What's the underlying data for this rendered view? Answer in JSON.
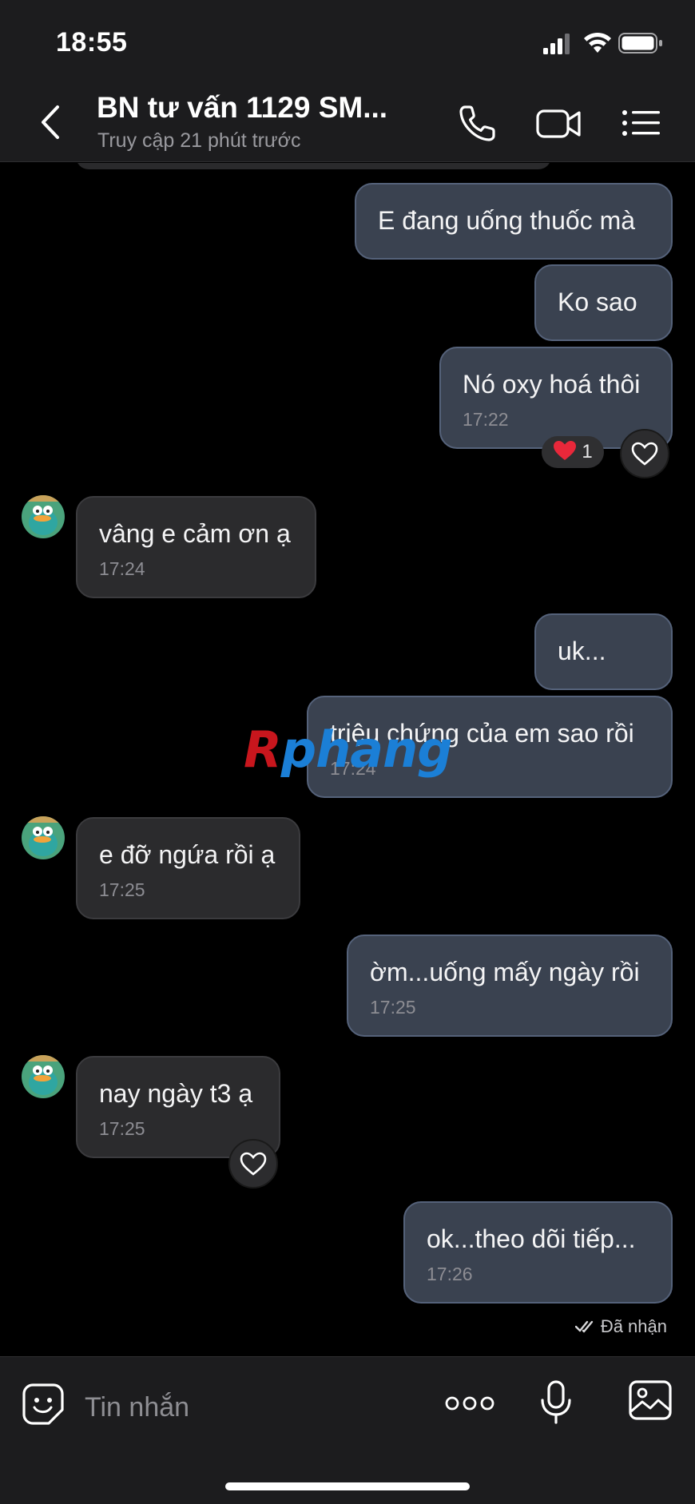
{
  "status_bar": {
    "time": "18:55"
  },
  "header": {
    "title": "BN tư vấn 1129 SM...",
    "subtitle": "Truy cập 21 phút trước"
  },
  "messages": [
    {
      "direction": "out",
      "text": "E đang uống thuốc mà",
      "time": ""
    },
    {
      "direction": "out",
      "text": "Ko sao",
      "time": ""
    },
    {
      "direction": "out",
      "text": "Nó oxy hoá thôi",
      "time": "17:22",
      "reaction": {
        "emoji": "❤️",
        "count": "1"
      }
    },
    {
      "direction": "in",
      "text": "vâng e cảm ơn ạ",
      "time": "17:24"
    },
    {
      "direction": "out",
      "text": "uk...",
      "time": ""
    },
    {
      "direction": "out",
      "text": "triệu chứng của em sao rồi",
      "time": "17:24"
    },
    {
      "direction": "in",
      "text": "e đỡ ngứa rồi ạ",
      "time": "17:25"
    },
    {
      "direction": "out",
      "text": "ờm...uống mấy ngày rồi",
      "time": "17:25"
    },
    {
      "direction": "in",
      "text": "nay ngày t3 ạ",
      "time": "17:25"
    },
    {
      "direction": "out",
      "text": "ok...theo dõi tiếp...",
      "time": "17:26"
    }
  ],
  "read_status": "Đã nhận",
  "watermark": {
    "first": "R",
    "rest": "phang"
  },
  "input": {
    "placeholder": "Tin nhắn"
  },
  "icons": {
    "back": "chevron-left-icon",
    "call": "phone-icon",
    "video": "video-camera-icon",
    "menu": "list-menu-icon",
    "sticker": "sticker-smile-icon",
    "more": "more-dots-icon",
    "mic": "microphone-icon",
    "image": "image-icon",
    "like": "heart-outline-icon",
    "read": "double-check-icon"
  },
  "colors": {
    "outgoing_bubble": "#3a4250",
    "incoming_bubble": "#2b2b2d",
    "background": "#000000",
    "bar": "#1c1c1e"
  }
}
